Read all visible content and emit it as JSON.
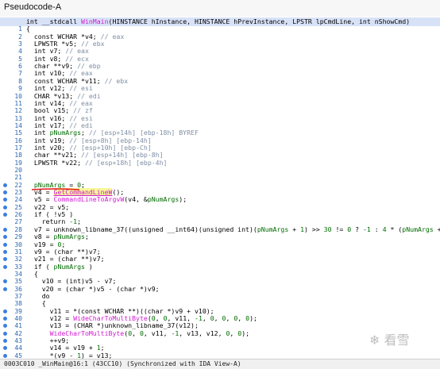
{
  "window": {
    "title": "Pseudocode-A"
  },
  "status_bar": "0003C010 _WinMain@16:1 (43CC10) (Synchronized with IDA View-A)",
  "watermark": "❄ 看雪",
  "code_lines": [
    {
      "no": "",
      "text": "int __stdcall WinMain(HINSTANCE hInstance, HINSTANCE hPrevInstance, LPSTR lpCmdLine, int nShowCmd)",
      "breakpoint": false,
      "highlight": true
    },
    {
      "no": "1",
      "text": "{",
      "breakpoint": false
    },
    {
      "no": "2",
      "text": "  const WCHAR *v4; // eax",
      "breakpoint": false
    },
    {
      "no": "3",
      "text": "  LPWSTR *v5; // ebx",
      "breakpoint": false
    },
    {
      "no": "4",
      "text": "  int v7; // eax",
      "breakpoint": false
    },
    {
      "no": "5",
      "text": "  int v8; // ecx",
      "breakpoint": false
    },
    {
      "no": "6",
      "text": "  char **v9; // ebp",
      "breakpoint": false
    },
    {
      "no": "7",
      "text": "  int v10; // eax",
      "breakpoint": false
    },
    {
      "no": "8",
      "text": "  const WCHAR *v11; // ebx",
      "breakpoint": false
    },
    {
      "no": "9",
      "text": "  int v12; // esi",
      "breakpoint": false
    },
    {
      "no": "10",
      "text": "  CHAR *v13; // edi",
      "breakpoint": false
    },
    {
      "no": "11",
      "text": "  int v14; // eax",
      "breakpoint": false
    },
    {
      "no": "12",
      "text": "  bool v15; // zf",
      "breakpoint": false
    },
    {
      "no": "13",
      "text": "  int v16; // esi",
      "breakpoint": false
    },
    {
      "no": "14",
      "text": "  int v17; // edi",
      "breakpoint": false
    },
    {
      "no": "15",
      "text": "  int pNumArgs; // [esp+14h] [ebp-18h] BYREF",
      "breakpoint": false
    },
    {
      "no": "16",
      "text": "  int v19; // [esp+8h] [ebp-14h]",
      "breakpoint": false
    },
    {
      "no": "17",
      "text": "  int v20; // [esp+10h] [ebp-Ch]",
      "breakpoint": false
    },
    {
      "no": "18",
      "text": "  char **v21; // [esp+14h] [ebp-8h]",
      "breakpoint": false
    },
    {
      "no": "19",
      "text": "  LPWSTR *v22; // [esp+18h] [ebp-4h]",
      "breakpoint": false
    },
    {
      "no": "20",
      "text": "",
      "breakpoint": false
    },
    {
      "no": "21",
      "text": "",
      "breakpoint": false
    },
    {
      "no": "22",
      "text": "  pNumArgs = 0;",
      "breakpoint": true
    },
    {
      "no": "23",
      "text": "  v4 = GetCommandLineW();",
      "breakpoint": true
    },
    {
      "no": "24",
      "text": "  v5 = CommandLineToArgvW(v4, &pNumArgs);",
      "breakpoint": true
    },
    {
      "no": "25",
      "text": "  v22 = v5;",
      "breakpoint": true
    },
    {
      "no": "26",
      "text": "  if ( !v5 )",
      "breakpoint": true
    },
    {
      "no": "27",
      "text": "    return -1;",
      "breakpoint": false
    },
    {
      "no": "28",
      "text": "  v7 = unknown_libname_37((unsigned __int64)(unsigned int)(pNumArgs + 1) >> 30 != 0 ? -1 : 4 * (pNumArgs + 1));",
      "breakpoint": true
    },
    {
      "no": "29",
      "text": "  v8 = pNumArgs;",
      "breakpoint": true
    },
    {
      "no": "30",
      "text": "  v19 = 0;",
      "breakpoint": true
    },
    {
      "no": "31",
      "text": "  v9 = (char **)v7;",
      "breakpoint": true
    },
    {
      "no": "32",
      "text": "  v21 = (char **)v7;",
      "breakpoint": true
    },
    {
      "no": "33",
      "text": "  if ( pNumArgs )",
      "breakpoint": true
    },
    {
      "no": "34",
      "text": "  {",
      "breakpoint": false
    },
    {
      "no": "35",
      "text": "    v10 = (int)v5 - v7;",
      "breakpoint": true
    },
    {
      "no": "36",
      "text": "    v20 = (char *)v5 - (char *)v9;",
      "breakpoint": true
    },
    {
      "no": "37",
      "text": "    do",
      "breakpoint": false
    },
    {
      "no": "38",
      "text": "    {",
      "breakpoint": false
    },
    {
      "no": "39",
      "text": "      v11 = *(const WCHAR **)((char *)v9 + v10);",
      "breakpoint": true
    },
    {
      "no": "40",
      "text": "      v12 = WideCharToMultiByte(0, 0, v11, -1, 0, 0, 0, 0);",
      "breakpoint": true
    },
    {
      "no": "41",
      "text": "      v13 = (CHAR *)unknown_libname_37(v12);",
      "breakpoint": true
    },
    {
      "no": "42",
      "text": "      WideCharToMultiByte(0, 0, v11, -1, v13, v12, 0, 0);",
      "breakpoint": true
    },
    {
      "no": "43",
      "text": "      ++v9;",
      "breakpoint": true
    },
    {
      "no": "44",
      "text": "      v14 = v19 + 1;",
      "breakpoint": true
    },
    {
      "no": "45",
      "text": "      *(v9 - 1) = v13;",
      "breakpoint": true
    },
    {
      "no": "46",
      "text": "      v8 = pNumArgs;",
      "breakpoint": true
    }
  ]
}
